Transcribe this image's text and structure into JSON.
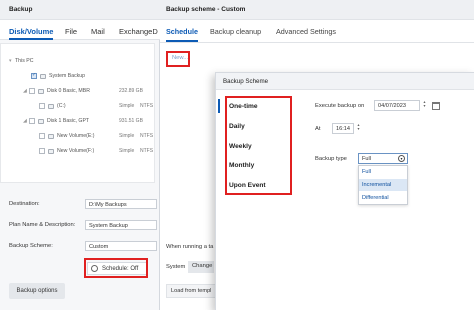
{
  "backup_window": {
    "title": "Backup",
    "tabs": [
      "Disk/Volume",
      "File",
      "Mail",
      "ExchangeD"
    ],
    "tree": {
      "root": "This PC",
      "system_backup": "System Backup",
      "disk0": {
        "label": "Disk 0 Basic, MBR",
        "size": "232.89 GB"
      },
      "c_drive": {
        "label": "(C:)",
        "type": "Simple",
        "size": "NTFS"
      },
      "disk1": {
        "label": "Disk 1 Basic, GPT",
        "size": "931.51 GB"
      },
      "e_drive": {
        "label": "New Volume(E:)",
        "type": "Simple",
        "size": "NTFS"
      },
      "f_drive": {
        "label": "New Volume(F:)",
        "type": "Simple",
        "size": "NTFS"
      }
    },
    "fields": {
      "destination_label": "Destination:",
      "destination_value": "D:\\My Backups",
      "plan_label": "Plan Name & Description:",
      "plan_value": "System Backup",
      "scheme_label": "Backup Scheme:",
      "scheme_value": "Custom"
    },
    "schedule_button": "Schedule: Off",
    "backup_options_button": "Backup options"
  },
  "scheme_window": {
    "title": "Backup scheme - Custom",
    "tabs": [
      "Schedule",
      "Backup cleanup",
      "Advanced Settings"
    ],
    "new_link": "New...",
    "running_text": "When running a ta",
    "system_label": "System",
    "change_button": "Change",
    "load_button": "Load from templ"
  },
  "scheme_panel": {
    "title": "Backup Scheme",
    "frequencies": [
      "One-time",
      "Daily",
      "Weekly",
      "Monthly",
      "Upon Event"
    ],
    "execute_label": "Execute backup on",
    "date_value": "04/07/2023",
    "at_label": "At",
    "time_value": "16:14",
    "backup_type_label": "Backup type",
    "backup_type_value": "Full",
    "backup_type_options": [
      "Full",
      "Incremental",
      "Differential"
    ],
    "selected_option": "Incremental"
  },
  "colors": {
    "accent": "#0d5bb5",
    "highlight_box": "#e02020",
    "selection": "#dbe7f5"
  }
}
